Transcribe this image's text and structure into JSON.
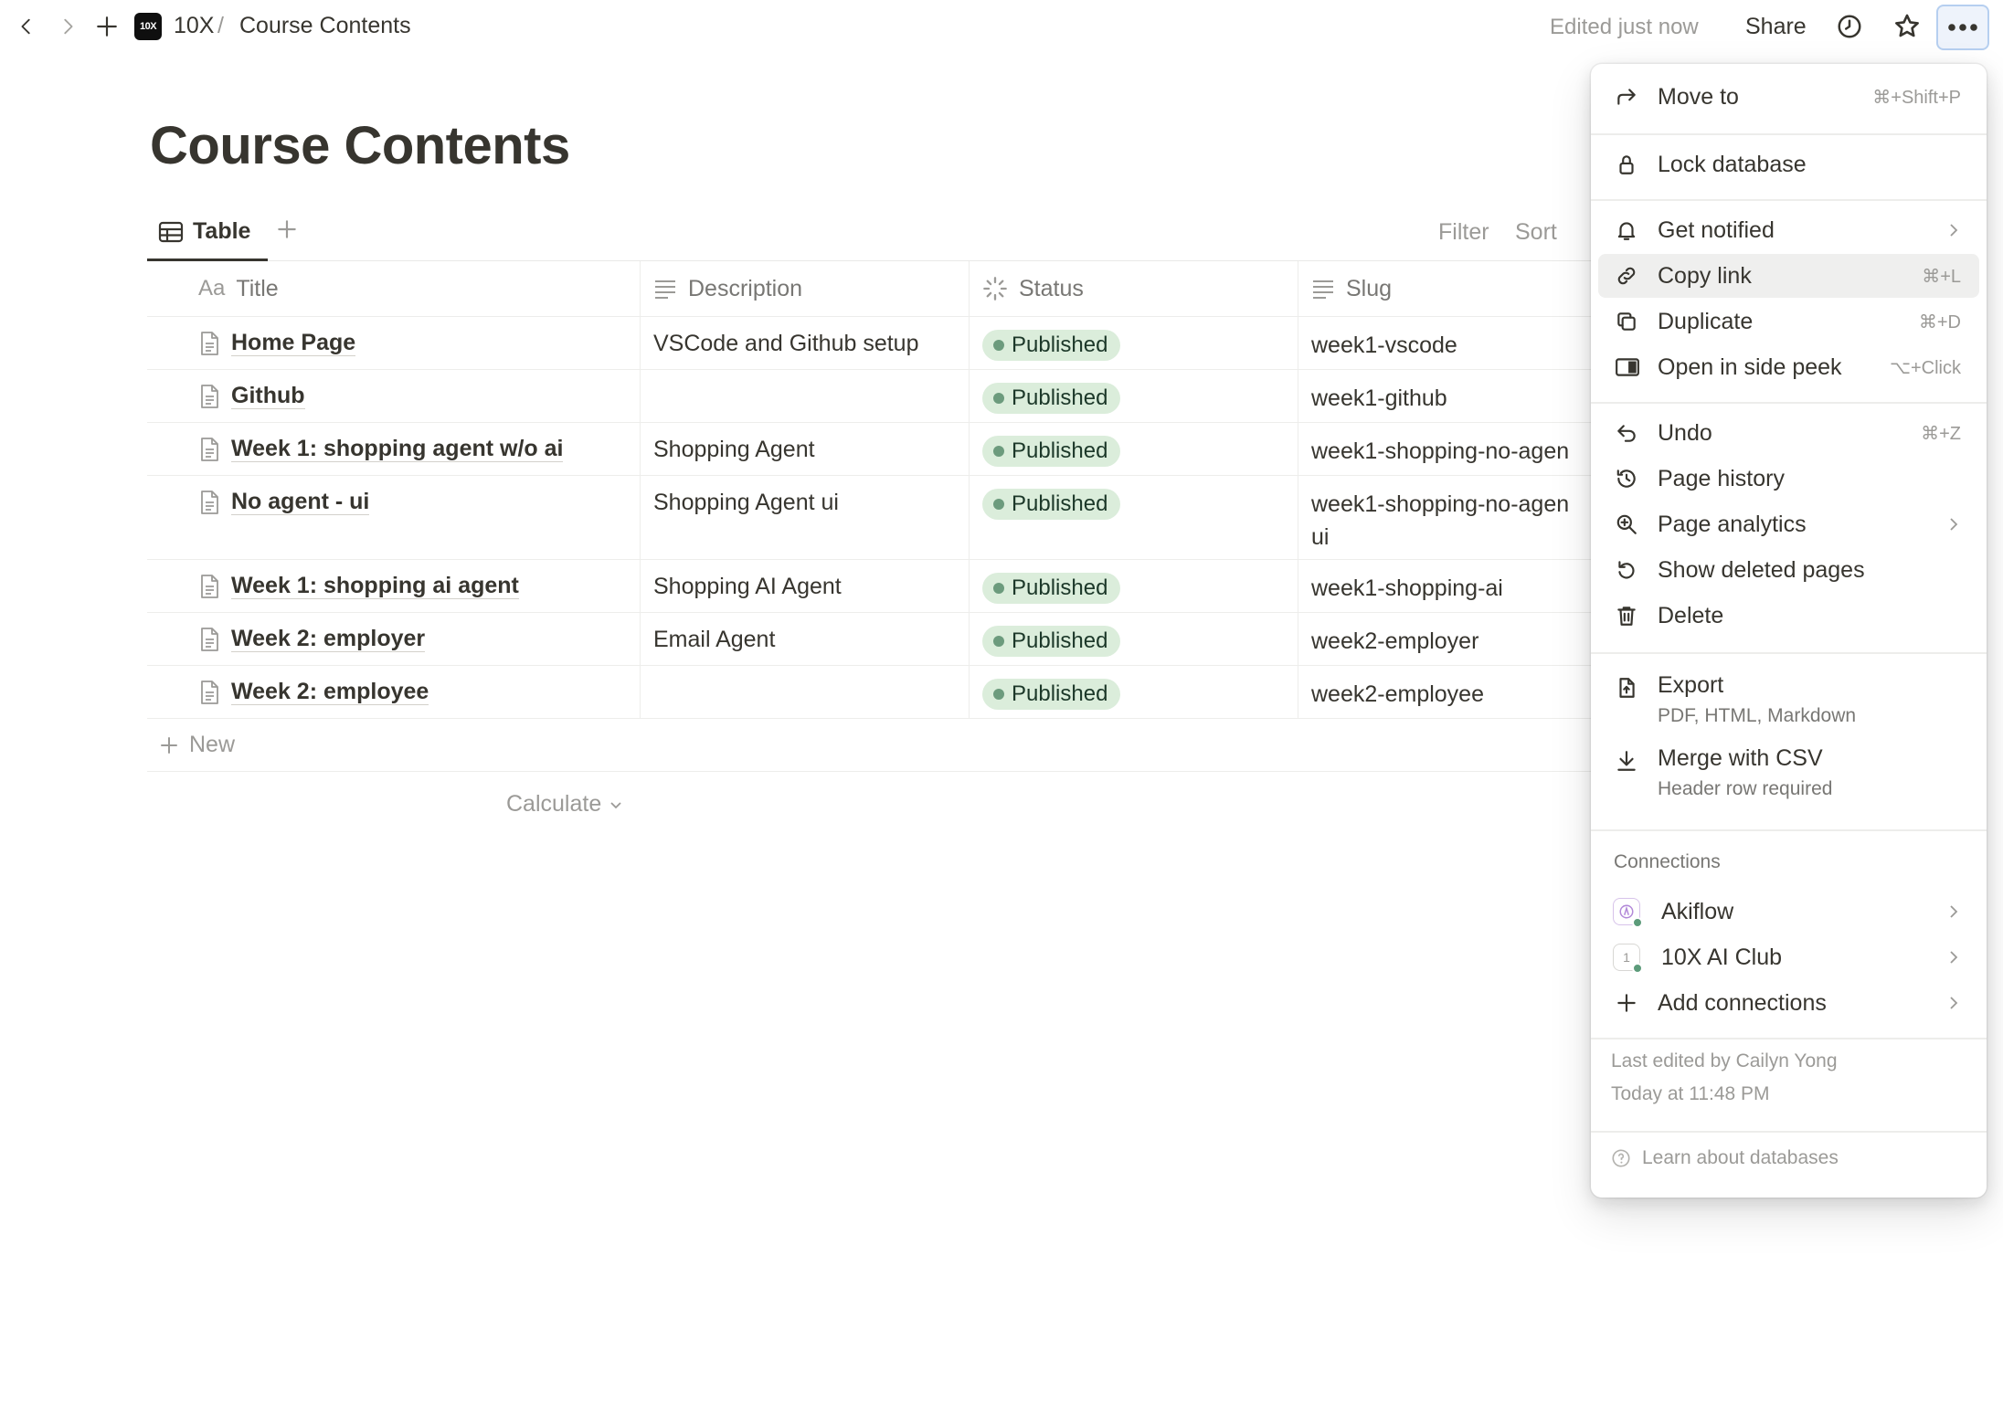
{
  "topbar": {
    "workspace": "10X",
    "logo_text": "10X",
    "separator": "/",
    "page": "Course Contents",
    "edited": "Edited just now",
    "share": "Share"
  },
  "page": {
    "title": "Course Contents"
  },
  "views": {
    "active_tab": "Table",
    "filter": "Filter",
    "sort": "Sort"
  },
  "table": {
    "columns": {
      "title_prefix": "Aa",
      "title": "Title",
      "description": "Description",
      "status": "Status",
      "slug": "Slug"
    },
    "rows": [
      {
        "title": "Home Page",
        "description": "VSCode and Github setup",
        "status": "Published",
        "slug": "week1-vscode"
      },
      {
        "title": "Github",
        "description": "",
        "status": "Published",
        "slug": "week1-github"
      },
      {
        "title": "Week 1: shopping agent w/o ai",
        "description": "Shopping Agent",
        "status": "Published",
        "slug": "week1-shopping-no-agen"
      },
      {
        "title": "No agent - ui",
        "description": "Shopping Agent ui",
        "status": "Published",
        "slug": "week1-shopping-no-agen ui"
      },
      {
        "title": "Week 1: shopping ai agent",
        "description": "Shopping AI Agent",
        "status": "Published",
        "slug": "week1-shopping-ai"
      },
      {
        "title": "Week 2: employer",
        "description": "Email Agent",
        "status": "Published",
        "slug": "week2-employer"
      },
      {
        "title": "Week 2: employee",
        "description": "",
        "status": "Published",
        "slug": "week2-employee"
      }
    ],
    "new_label": "New",
    "calculate": "Calculate"
  },
  "menu": {
    "move_to": {
      "label": "Move to",
      "shortcut": "⌘+Shift+P"
    },
    "lock": {
      "label": "Lock database"
    },
    "notify": {
      "label": "Get notified"
    },
    "copy_link": {
      "label": "Copy link",
      "shortcut": "⌘+L"
    },
    "duplicate": {
      "label": "Duplicate",
      "shortcut": "⌘+D"
    },
    "side_peek": {
      "label": "Open in side peek",
      "shortcut": "⌥+Click"
    },
    "undo": {
      "label": "Undo",
      "shortcut": "⌘+Z"
    },
    "history": {
      "label": "Page history"
    },
    "analytics": {
      "label": "Page analytics"
    },
    "deleted": {
      "label": "Show deleted pages"
    },
    "delete": {
      "label": "Delete"
    },
    "export": {
      "label": "Export",
      "sub": "PDF, HTML, Markdown"
    },
    "merge": {
      "label": "Merge with CSV",
      "sub": "Header row required"
    },
    "connections_title": "Connections",
    "connections": [
      {
        "label": "Akiflow",
        "icon": "akiflow-icon"
      },
      {
        "label": "10X AI Club",
        "icon": "10x-ai-club-icon",
        "icon_text": "1"
      }
    ],
    "add_connections": {
      "label": "Add connections"
    },
    "last_edited_by": "Last edited by Cailyn Yong",
    "last_edited_time": "Today at 11:48 PM",
    "learn": "Learn about databases"
  },
  "colors": {
    "status_bg": "#dbeddb",
    "status_dot": "#6c9b7d",
    "active_button_border": "#b6cff0"
  }
}
